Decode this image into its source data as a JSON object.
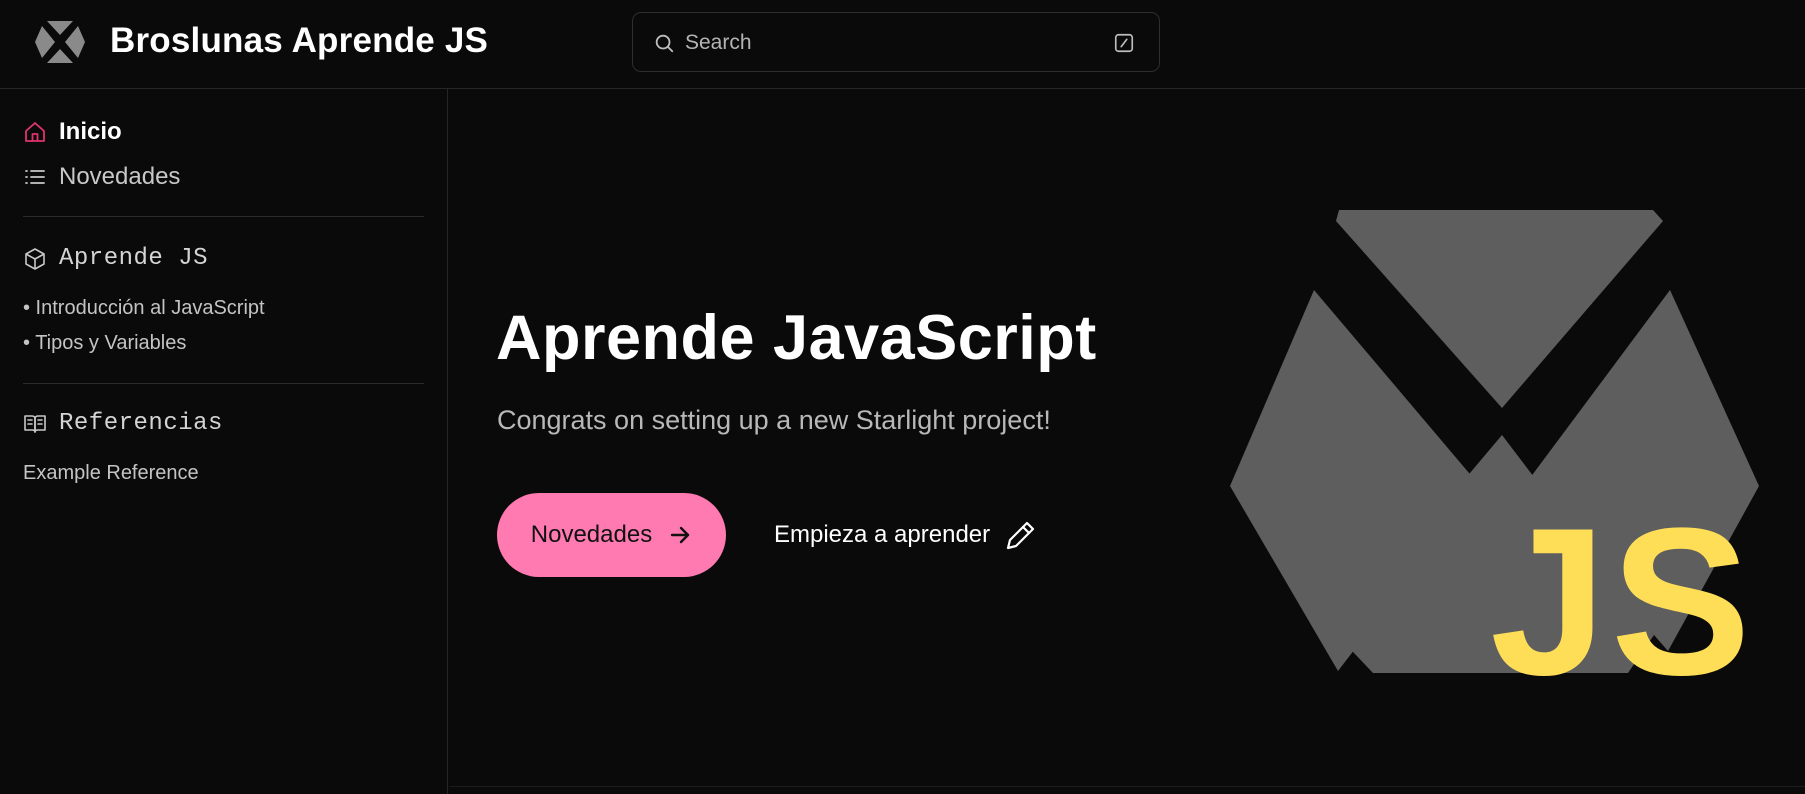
{
  "header": {
    "site_title": "Broslunas Aprende JS",
    "logo_icon": "hexagon-x-logo-icon",
    "search": {
      "placeholder": "Search",
      "icon": "search-icon",
      "shortcut_icon": "slash-key-icon"
    }
  },
  "sidebar": {
    "top_links": [
      {
        "label": "Inicio",
        "icon": "home-icon",
        "active": true,
        "accent": "#e0336e"
      },
      {
        "label": "Novedades",
        "icon": "list-icon",
        "active": false
      }
    ],
    "groups": [
      {
        "title": "Aprende JS",
        "icon": "cube-icon",
        "links": [
          "• Introducción al JavaScript",
          "• Tipos y Variables"
        ]
      },
      {
        "title": "Referencias",
        "icon": "open-book-icon",
        "links": [
          "Example Reference"
        ]
      }
    ]
  },
  "hero": {
    "title": "Aprende JavaScript",
    "tagline": "Congrats on setting up a new Starlight project!",
    "primary_action": {
      "label": "Novedades",
      "icon": "arrow-right-icon",
      "color": "#ff7ab0"
    },
    "secondary_action": {
      "label": "Empieza a aprender",
      "icon": "pencil-icon"
    },
    "image": {
      "text": "JS",
      "text_color": "#ffde57",
      "shape_color": "#5e5e5e"
    }
  }
}
